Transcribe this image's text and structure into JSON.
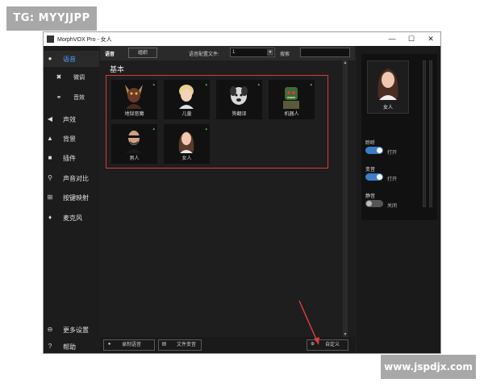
{
  "watermarks": {
    "top_left": "TG: MYYJJPP",
    "bottom_right": "www.jspdjx.com"
  },
  "window": {
    "title": "MorphVOX Pro - 女人",
    "controls": [
      "—",
      "☐",
      "✕"
    ]
  },
  "sidebar": {
    "items": [
      {
        "label": "语音",
        "icon": "voice-icon",
        "active": true
      },
      {
        "label": "微调",
        "icon": "tweak-icon",
        "sub": true
      },
      {
        "label": "音效",
        "icon": "effects-icon",
        "sub": true
      },
      {
        "label": "声效",
        "icon": "sound-icon"
      },
      {
        "label": "背景",
        "icon": "background-icon"
      },
      {
        "label": "插件",
        "icon": "plugin-icon"
      },
      {
        "label": "声音对比",
        "icon": "compare-icon"
      },
      {
        "label": "按键映射",
        "icon": "keymap-icon"
      },
      {
        "label": "麦克风",
        "icon": "mic-icon"
      }
    ],
    "bottom_items": [
      {
        "label": "更多设置",
        "icon": "settings-icon"
      },
      {
        "label": "帮助",
        "icon": "help-icon"
      }
    ]
  },
  "toolbar": {
    "tab_label": "语音",
    "manage_button": "组织",
    "profile_label": "语音配置文件:",
    "profile_value": "1",
    "search_label": "搜索"
  },
  "section": {
    "title": "基本"
  },
  "voices": [
    {
      "name": "地狱恶魔",
      "icon": "demon-avatar"
    },
    {
      "name": "儿童",
      "icon": "child-avatar"
    },
    {
      "name": "狗翻译",
      "icon": "dog-avatar"
    },
    {
      "name": "机器人",
      "icon": "robot-avatar"
    },
    {
      "name": "男人",
      "icon": "man-avatar"
    },
    {
      "name": "女人",
      "icon": "woman-avatar"
    }
  ],
  "bottombar": {
    "record_label": "录制语音",
    "file_label": "文件变音",
    "custom_label": "自定义"
  },
  "right_panel": {
    "selected_voice": "女人",
    "monitor_label": "聆听",
    "monitor_state": "打开",
    "morph_label": "变音",
    "morph_state": "打开",
    "mute_label": "静音",
    "mute_state": "关闭"
  },
  "colors": {
    "accent": "#3a7ec8",
    "highlight_box": "#d83a3a",
    "arrow": "#d83a3a"
  }
}
